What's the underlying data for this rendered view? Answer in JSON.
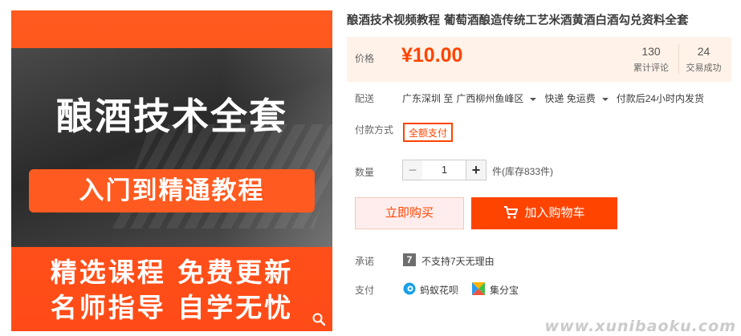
{
  "image": {
    "title": "酿酒技术全套",
    "banner": "入门到精通教程",
    "line1": "精选课程 免费更新",
    "line2": "名师指导 自学无忧",
    "zoom_icon": "zoom-icon"
  },
  "product": {
    "title": "酿酒技术视频教程 葡萄酒酿造传统工艺米酒黄酒白酒勾兑资料全套"
  },
  "price": {
    "label": "价格",
    "value": "¥10.00",
    "reviews_count": "130",
    "reviews_label": "累计评论",
    "sales_count": "24",
    "sales_label": "交易成功"
  },
  "shipping": {
    "label": "配送",
    "from": "广东深圳 至",
    "to": "广西柳州鱼峰区",
    "method": "快递 免运费",
    "dispatch": "付款后24小时内发货"
  },
  "payment_method": {
    "label": "付款方式",
    "option": "全额支付"
  },
  "quantity": {
    "label": "数量",
    "minus": "−",
    "value": "1",
    "plus": "+",
    "stock": "件(库存833件)"
  },
  "actions": {
    "buy_now": "立即购买",
    "add_to_cart": "加入购物车"
  },
  "promise": {
    "label": "承诺",
    "icon_text": "7",
    "text": "不支持7天无理由"
  },
  "pay": {
    "label": "支付",
    "huabei": "蚂蚁花呗",
    "jifenbao": "集分宝"
  },
  "watermark": "www.xunibaoku.com",
  "colors": {
    "accent": "#ff4400",
    "price_bg": "#fff2e8",
    "image_orange": "#ff5a1f"
  }
}
